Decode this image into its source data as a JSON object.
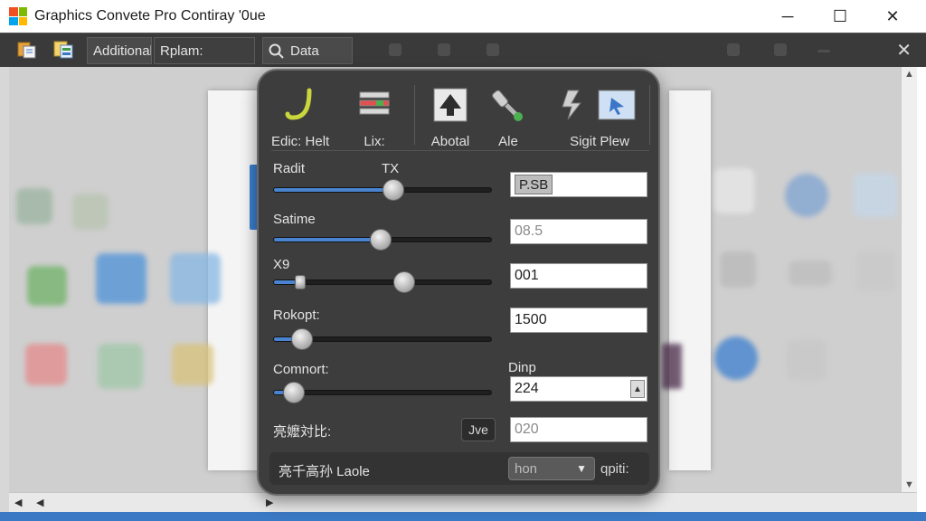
{
  "window": {
    "title": "Graphics Convete Pro Contiray '0ue",
    "minimize": "─",
    "maximize": "☐",
    "close": "✕"
  },
  "toolbar": {
    "tab_additional": "Additional",
    "tab_rplam": "Rplam:",
    "tab_data": "Data",
    "close": "✕"
  },
  "panel": {
    "tools": [
      {
        "label": "Edic: Helt",
        "icon": "hook-curve-icon"
      },
      {
        "label": "Lix:",
        "icon": "layers-list-icon"
      },
      {
        "label": "Abotal",
        "icon": "arrow-up-icon"
      },
      {
        "label": "Ale",
        "icon": "brush-icon"
      },
      {
        "label": "Sigit Plew",
        "icon": "cursor-shape-icon"
      }
    ],
    "rows": [
      {
        "label": "Radit",
        "label2": "TX",
        "value": 0.55,
        "field_tag": "P.SB",
        "field": ""
      },
      {
        "label": "Satime",
        "value": 0.49,
        "field": "08.5"
      },
      {
        "label": "X9",
        "value": 0.12,
        "knob2": 0.6,
        "field": "001"
      },
      {
        "label": "Rokopt:",
        "value": 0.13,
        "field": "1500"
      },
      {
        "label": "Comnort:",
        "value": 0.09,
        "field_label": "Dinp",
        "field": "224"
      },
      {
        "label": "亮嬤対比:",
        "button": "Jve",
        "field": "020"
      }
    ],
    "footer": {
      "label": "亮千高孙 Laole",
      "dropdown": "hon",
      "right": "qpiti:"
    }
  },
  "colors": {
    "accent": "#4a84d0",
    "panel_bg": "#3d3d3d",
    "toolbar_bg": "#3a3a3a"
  }
}
